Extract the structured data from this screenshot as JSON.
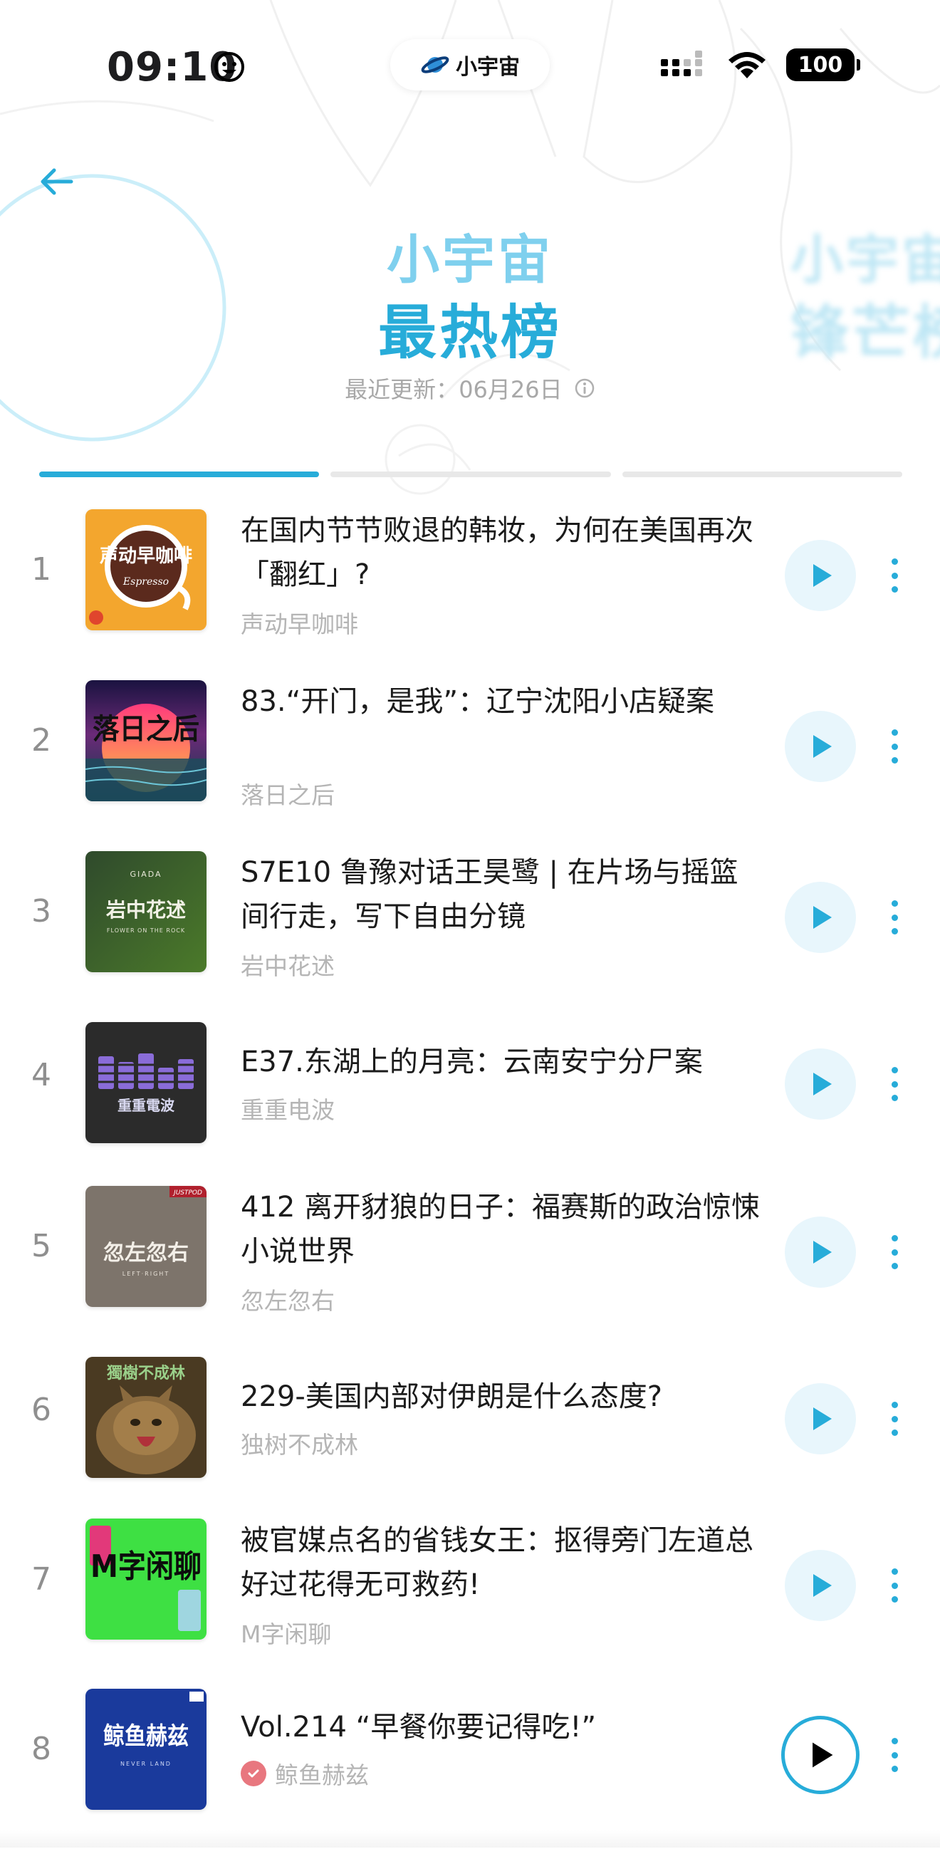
{
  "status_bar": {
    "time": "09:10",
    "app_pill": "小宇宙",
    "battery": "100"
  },
  "header": {
    "title_line1": "小宇宙",
    "title_line2": "最热榜",
    "peek_line1": "小宇宙",
    "peek_line2": "锋芒榜",
    "update_label": "最近更新：",
    "update_date": "06月26日"
  },
  "tabs": [
    {
      "name": "tab-1",
      "active": true
    },
    {
      "name": "tab-2",
      "active": false
    },
    {
      "name": "tab-3",
      "active": false
    }
  ],
  "colors": {
    "accent": "#27acd9",
    "accent_light": "#7fd0ee",
    "play_bg": "#e8f6fc",
    "muted_text": "#b5b5b5",
    "rank_text": "#8f8f8f"
  },
  "episodes": [
    {
      "rank": "1",
      "title": "在国内节节败退的韩妆，为何在美国再次「翻红」?",
      "podcast": "声动早咖啡",
      "cover_text": "声动早咖啡",
      "cover_sub": "Espresso"
    },
    {
      "rank": "2",
      "title": "83.“开门，是我”：辽宁沈阳小店疑案",
      "podcast": "落日之后",
      "cover_text": "落日之后"
    },
    {
      "rank": "3",
      "title": "S7E10 鲁豫对话王昊鹭 | 在片场与摇篮间行走，写下自由分镜",
      "podcast": "岩中花述",
      "cover_text": "岩中花述",
      "cover_top": "GIADA",
      "cover_sub": "FLOWER ON THE ROCK"
    },
    {
      "rank": "4",
      "title": "E37.东湖上的月亮：云南安宁分尸案",
      "podcast": "重重电波",
      "cover_text": "重重電波"
    },
    {
      "rank": "5",
      "title": "412 离开豺狼的日子：福赛斯的政治惊悚小说世界",
      "podcast": "忽左忽右",
      "cover_text": "忽左忽右",
      "cover_sub": "LEFT·RIGHT",
      "cover_badge": "JUSTPOD"
    },
    {
      "rank": "6",
      "title": "229-美国内部对伊朗是什么态度?",
      "podcast": "独树不成林",
      "cover_text": "獨樹不成林"
    },
    {
      "rank": "7",
      "title": "被官媒点名的省钱女王：抠得旁门左道总好过花得无可救药!",
      "podcast": "M字闲聊",
      "cover_text": "M字闲聊"
    },
    {
      "rank": "8",
      "title": "Vol.214 “早餐你要记得吃!”",
      "podcast": "鲸鱼赫兹",
      "cover_text": "鲸鱼赫兹",
      "cover_sub": "NEVER LAND",
      "verified": true,
      "playing": true
    }
  ]
}
